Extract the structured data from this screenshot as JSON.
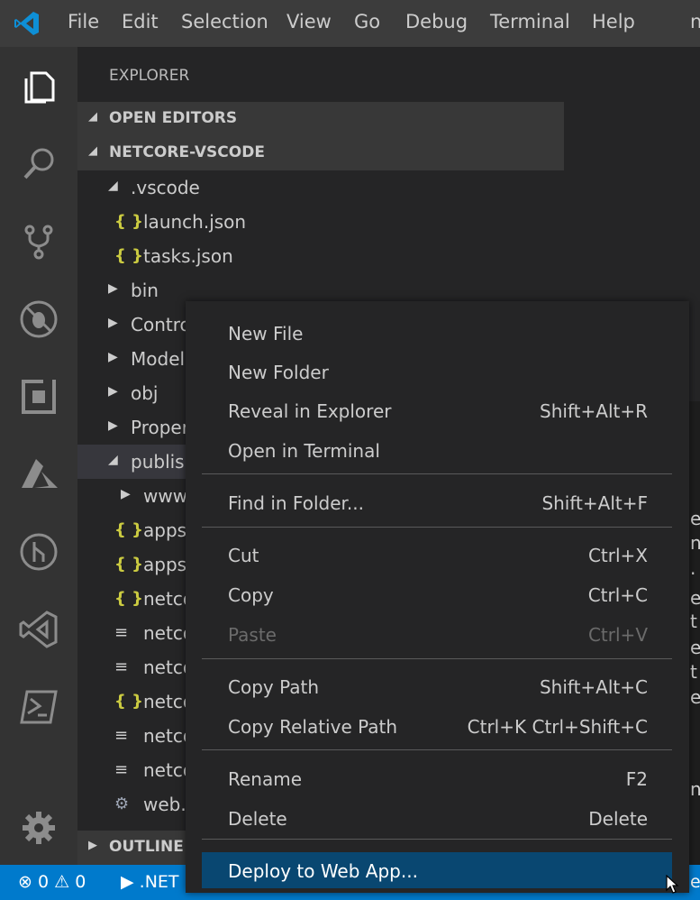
{
  "menubar": {
    "items": [
      "File",
      "Edit",
      "Selection",
      "View",
      "Go",
      "Debug",
      "Terminal",
      "Help"
    ],
    "overflow": "n"
  },
  "activity": {
    "icons": [
      "explorer-icon",
      "search-icon",
      "source-control-icon",
      "debug-icon",
      "extensions-icon",
      "azure-icon",
      "git-graph-icon",
      "visual-studio-icon",
      "powershell-icon",
      "settings-gear-icon"
    ]
  },
  "sidebar": {
    "title": "EXPLORER",
    "open_editors": "OPEN EDITORS",
    "project": "NETCORE-VSCODE",
    "outline": "OUTLINE",
    "tree": [
      {
        "name": ".vscode",
        "icon": "chevron-down",
        "indent": 1
      },
      {
        "name": "launch.json",
        "icon": "json-braces",
        "indent": 2
      },
      {
        "name": "tasks.json",
        "icon": "json-braces",
        "indent": 2
      },
      {
        "name": "bin",
        "icon": "chevron-right",
        "indent": 1
      },
      {
        "name": "Contro",
        "icon": "chevron-right",
        "indent": 1
      },
      {
        "name": "Model",
        "icon": "chevron-right",
        "indent": 1
      },
      {
        "name": "obj",
        "icon": "chevron-right",
        "indent": 1
      },
      {
        "name": "Proper",
        "icon": "chevron-right",
        "indent": 1
      },
      {
        "name": "publis",
        "icon": "chevron-down",
        "indent": 1,
        "selected": true
      },
      {
        "name": "www",
        "icon": "chevron-right",
        "indent": 2
      },
      {
        "name": "apps",
        "icon": "json-braces",
        "indent": 2
      },
      {
        "name": "apps",
        "icon": "json-braces",
        "indent": 2
      },
      {
        "name": "netco",
        "icon": "json-braces",
        "indent": 2
      },
      {
        "name": "netco",
        "icon": "lines",
        "indent": 2
      },
      {
        "name": "netco",
        "icon": "lines",
        "indent": 2
      },
      {
        "name": "netco",
        "icon": "json-braces",
        "indent": 2
      },
      {
        "name": "netco",
        "icon": "lines",
        "indent": 2
      },
      {
        "name": "netco",
        "icon": "lines",
        "indent": 2
      },
      {
        "name": "web.",
        "icon": "gear",
        "indent": 2
      }
    ]
  },
  "editor": {
    "fragments": [
      "e",
      "n",
      ".",
      "e",
      "t",
      "e",
      "t",
      "e",
      "n",
      "e"
    ]
  },
  "context_menu": {
    "groups": [
      [
        {
          "label": "New File",
          "shortcut": ""
        },
        {
          "label": "New Folder",
          "shortcut": ""
        },
        {
          "label": "Reveal in Explorer",
          "shortcut": "Shift+Alt+R"
        },
        {
          "label": "Open in Terminal",
          "shortcut": ""
        }
      ],
      [
        {
          "label": "Find in Folder...",
          "shortcut": "Shift+Alt+F"
        }
      ],
      [
        {
          "label": "Cut",
          "shortcut": "Ctrl+X"
        },
        {
          "label": "Copy",
          "shortcut": "Ctrl+C"
        },
        {
          "label": "Paste",
          "shortcut": "Ctrl+V",
          "disabled": true
        }
      ],
      [
        {
          "label": "Copy Path",
          "shortcut": "Shift+Alt+C"
        },
        {
          "label": "Copy Relative Path",
          "shortcut": "Ctrl+K Ctrl+Shift+C"
        }
      ],
      [
        {
          "label": "Rename",
          "shortcut": "F2"
        },
        {
          "label": "Delete",
          "shortcut": "Delete"
        }
      ],
      [
        {
          "label": "Deploy to Web App...",
          "shortcut": "",
          "highlighted": true
        }
      ]
    ]
  },
  "status": {
    "errors": "0",
    "warnings": "0",
    "runtime": ".NET",
    "right_fragment": "e"
  },
  "colors": {
    "statusbar": "#007acc",
    "activitybar": "#333333",
    "sidebar": "#252526",
    "menu_highlight": "#094771",
    "json_icon": "#cbcb41"
  }
}
